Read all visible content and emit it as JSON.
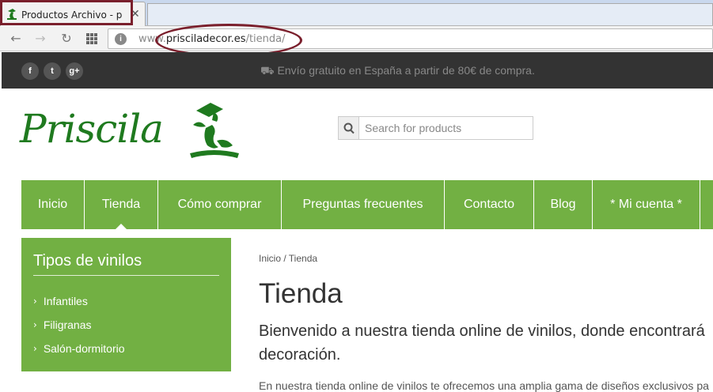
{
  "browser": {
    "tab_title": "Productos Archivo - pris",
    "tab_close": "✕",
    "url_prefix": "www.",
    "url_domain": "prisciladecor.es",
    "url_path": "/tienda/"
  },
  "topbar": {
    "social": [
      "f",
      "t",
      "g+"
    ],
    "shipping": "Envío gratuito en España a partir de 80€ de compra."
  },
  "logo": {
    "text": "Priscila"
  },
  "search": {
    "placeholder": "Search for products"
  },
  "nav": {
    "items": [
      "Inicio",
      "Tienda",
      "Cómo comprar",
      "Preguntas frecuentes",
      "Contacto",
      "Blog",
      "* Mi cuenta *"
    ]
  },
  "sidebar": {
    "title": "Tipos de vinilos",
    "items": [
      "Infantiles",
      "Filigranas",
      "Salón-dormitorio"
    ]
  },
  "content": {
    "breadcrumb": "Inicio / Tienda",
    "title": "Tienda",
    "lead": "Bienvenido a nuestra tienda online de vinilos, donde encontrará decoración.",
    "body": "En nuestra tienda online de vinilos te ofrecemos una amplia gama de diseños exclusivos pa"
  },
  "colors": {
    "accent": "#72b043",
    "topbar": "#333333",
    "logo": "#1f7a1f",
    "annotation": "#7a1f2c"
  }
}
